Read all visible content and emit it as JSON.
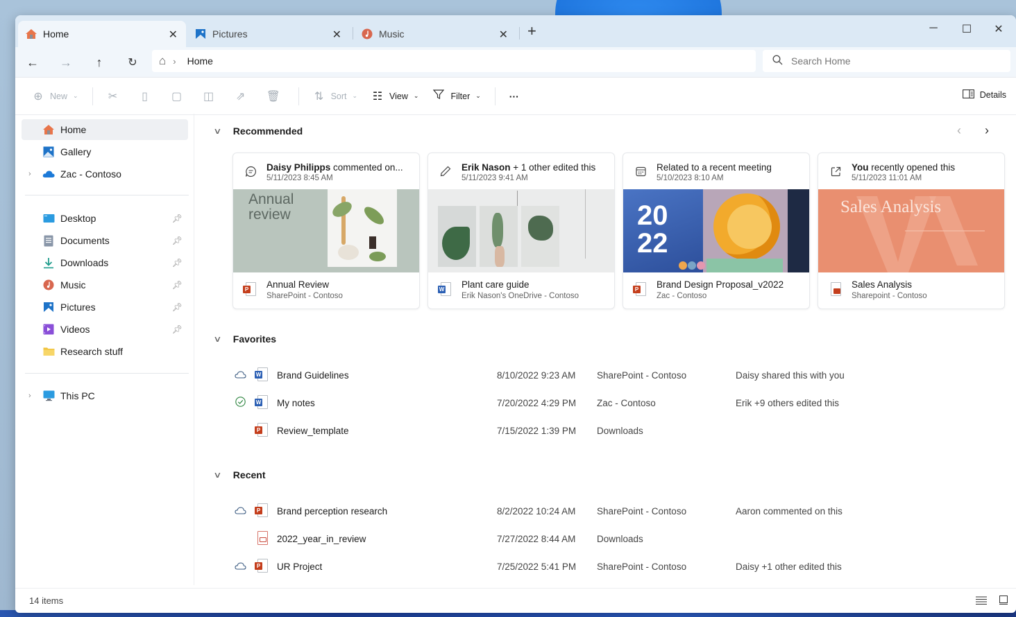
{
  "tabs": [
    {
      "label": "Home",
      "icon": "home-icon",
      "active": true
    },
    {
      "label": "Pictures",
      "icon": "pictures-icon",
      "active": false
    },
    {
      "label": "Music",
      "icon": "music-icon",
      "active": false
    }
  ],
  "window_controls": {
    "minimize": "─",
    "maximize": "☐",
    "close": "✕",
    "new_tab": "+"
  },
  "address": {
    "home_glyph": "⌂",
    "breadcrumb": "Home"
  },
  "search": {
    "placeholder": "Search Home"
  },
  "command_bar": {
    "new": "New",
    "sort": "Sort",
    "view": "View",
    "filter": "Filter",
    "more": "···",
    "details": "Details"
  },
  "sidebar": {
    "top": [
      {
        "label": "Home",
        "icon": "home-icon",
        "selected": true
      },
      {
        "label": "Gallery",
        "icon": "gallery-icon"
      },
      {
        "label": "Zac - Contoso",
        "icon": "onedrive-cloud-icon",
        "expandable": true
      }
    ],
    "pinned": [
      {
        "label": "Desktop",
        "icon": "desktop-icon",
        "pinned": true
      },
      {
        "label": "Documents",
        "icon": "documents-icon",
        "pinned": true
      },
      {
        "label": "Downloads",
        "icon": "downloads-icon",
        "pinned": true
      },
      {
        "label": "Music",
        "icon": "music-icon",
        "pinned": true
      },
      {
        "label": "Pictures",
        "icon": "pictures-icon",
        "pinned": true
      },
      {
        "label": "Videos",
        "icon": "videos-icon",
        "pinned": true
      },
      {
        "label": "Research stuff",
        "icon": "folder-icon",
        "pinned": false
      }
    ],
    "bottom": [
      {
        "label": "This PC",
        "icon": "pc-icon",
        "expandable": true
      }
    ]
  },
  "sections": {
    "recommended": "Recommended",
    "favorites": "Favorites",
    "recent": "Recent"
  },
  "recommended": [
    {
      "who": "Daisy Philipps",
      "what": " commented on...",
      "time": "5/11/2023 8:45 AM",
      "head_icon": "comment-icon",
      "name": "Annual Review",
      "location": "SharePoint - Contoso",
      "type": "powerpoint",
      "thumb_title": "Annual review"
    },
    {
      "who": "Erik Nason",
      "what": " + 1 other edited this",
      "time": "5/11/2023 9:41 AM",
      "head_icon": "edit-pencil-icon",
      "name": "Plant care guide",
      "location": "Erik Nason's OneDrive - Contoso",
      "type": "word",
      "thumb_title": ""
    },
    {
      "who": "",
      "what": "Related to a recent meeting",
      "time": "5/10/2023 8:10 AM",
      "head_icon": "calendar-icon",
      "name": "Brand Design Proposal_v2022",
      "location": "Zac - Contoso",
      "type": "powerpoint",
      "thumb_title": "20 22"
    },
    {
      "who": "You",
      "what": " recently opened this",
      "time": "5/11/2023 11:01 AM",
      "head_icon": "open-external-icon",
      "name": "Sales Analysis",
      "location": "Sharepoint - Contoso",
      "type": "powerpoint-doc",
      "thumb_title": "Sales Analysis"
    }
  ],
  "favorites": [
    {
      "status": "cloud",
      "type": "word",
      "name": "Brand Guidelines",
      "date": "8/10/2022 9:23 AM",
      "location": "SharePoint - Contoso",
      "activity": "Daisy shared this with you"
    },
    {
      "status": "synced",
      "type": "word",
      "name": "My notes",
      "date": "7/20/2022 4:29 PM",
      "location": "Zac - Contoso",
      "activity": "Erik +9 others edited this"
    },
    {
      "status": "",
      "type": "powerpoint",
      "name": "Review_template",
      "date": "7/15/2022 1:39 PM",
      "location": "Downloads",
      "activity": ""
    }
  ],
  "recent": [
    {
      "status": "cloud",
      "type": "powerpoint",
      "name": "Brand perception research",
      "date": "8/2/2022 10:24 AM",
      "location": "SharePoint - Contoso",
      "activity": "Aaron commented on this"
    },
    {
      "status": "",
      "type": "pdf",
      "name": "2022_year_in_review",
      "date": "7/27/2022 8:44 AM",
      "location": "Downloads",
      "activity": ""
    },
    {
      "status": "cloud",
      "type": "powerpoint",
      "name": "UR Project",
      "date": "7/25/2022 5:41 PM",
      "location": "SharePoint - Contoso",
      "activity": "Daisy +1 other edited this"
    }
  ],
  "status_bar": {
    "count": "14 items"
  },
  "colors": {
    "word": "#2b5fb4",
    "powerpoint": "#c43e1c",
    "synced": "#2e8540",
    "accent": "#0067c0"
  }
}
